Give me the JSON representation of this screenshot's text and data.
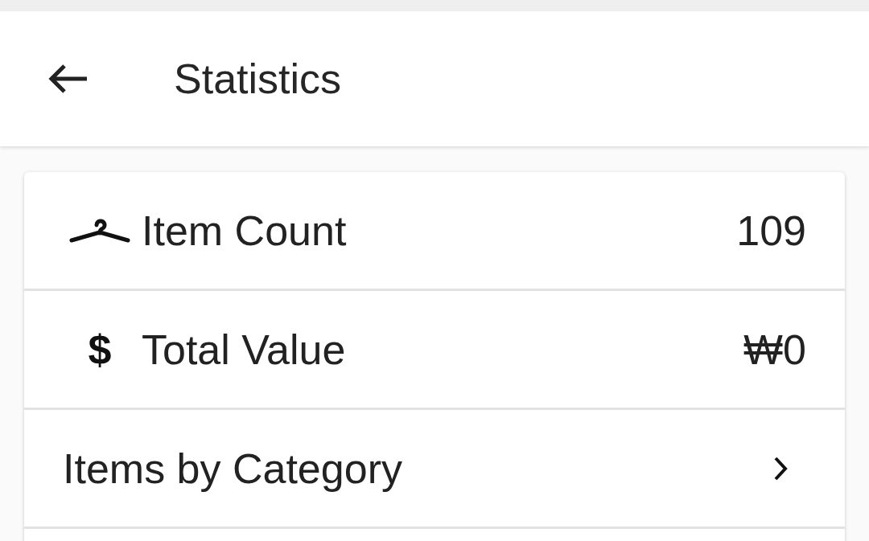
{
  "app_bar": {
    "title": "Statistics"
  },
  "rows": [
    {
      "kind": "stat",
      "label": "Item Count",
      "value": "109"
    },
    {
      "kind": "stat",
      "symbol": "$",
      "label": "Total Value",
      "value": "₩0"
    },
    {
      "kind": "link",
      "label": "Items by Category"
    }
  ]
}
